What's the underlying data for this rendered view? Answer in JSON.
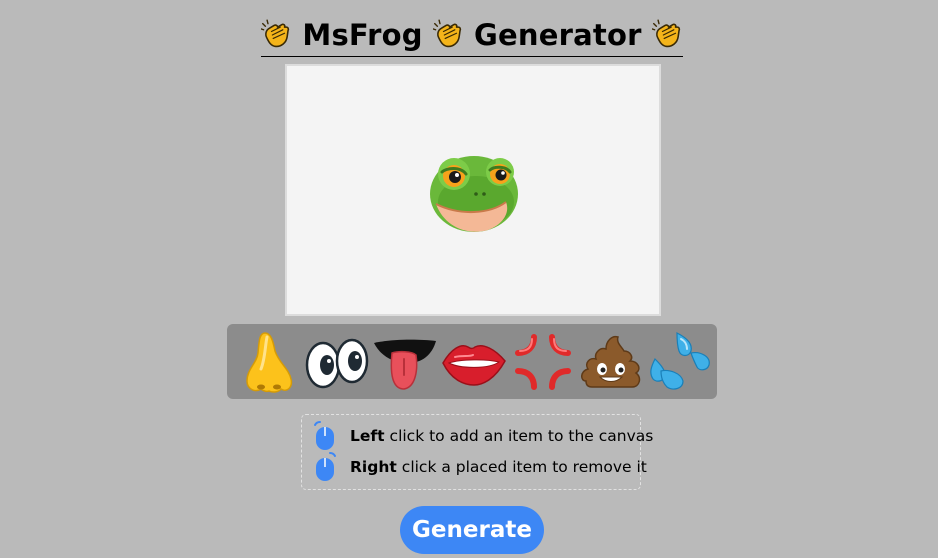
{
  "header": {
    "title_part1": "MsFrog",
    "title_part2": "Generator",
    "icon": "clapping-hands-icon"
  },
  "canvas": {
    "placed_items": [
      "frog-face-icon"
    ]
  },
  "palette": {
    "items": [
      {
        "name": "nose-icon"
      },
      {
        "name": "eyes-icon"
      },
      {
        "name": "tongue-mouth-icon"
      },
      {
        "name": "lips-icon"
      },
      {
        "name": "anger-symbol-icon"
      },
      {
        "name": "poop-icon"
      },
      {
        "name": "sweat-droplets-icon"
      }
    ]
  },
  "help": {
    "left_bold": "Left",
    "left_text": "click to add an item to the canvas",
    "right_bold": "Right",
    "right_text": "click a placed item to remove it"
  },
  "actions": {
    "generate_label": "Generate"
  },
  "colors": {
    "background": "#bababa",
    "canvas": "#f4f4f4",
    "palette": "#8c8c8c",
    "accent": "#3d87f5"
  }
}
